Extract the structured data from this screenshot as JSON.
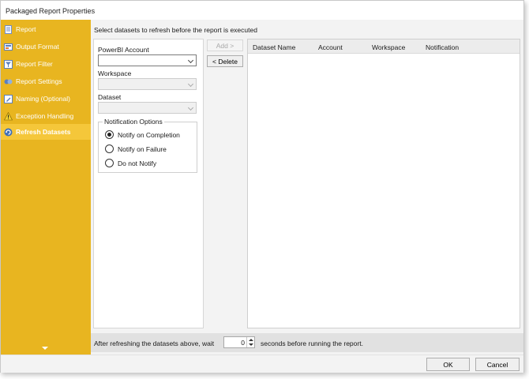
{
  "window": {
    "title": "Packaged Report Properties"
  },
  "sidebar": {
    "items": [
      {
        "label": "Report",
        "icon": "report-icon",
        "active": false
      },
      {
        "label": "Output Format",
        "icon": "output-format-icon",
        "active": false
      },
      {
        "label": "Report Filter",
        "icon": "filter-icon",
        "active": false
      },
      {
        "label": "Report Settings",
        "icon": "settings-icon",
        "active": false
      },
      {
        "label": "Naming (Optional)",
        "icon": "naming-icon",
        "active": false
      },
      {
        "label": "Exception Handling",
        "icon": "warning-icon",
        "active": false
      },
      {
        "label": "Refresh Datasets",
        "icon": "refresh-icon",
        "active": true
      }
    ],
    "expand_icon": "chevron-down-icon"
  },
  "main": {
    "instruction": "Select datasets to refresh before the report is executed",
    "powerbi_account_label": "PowerBI Account",
    "powerbi_account_value": "",
    "workspace_label": "Workspace",
    "workspace_value": "",
    "dataset_label": "Dataset",
    "dataset_value": "",
    "notification_title": "Notification Options",
    "notification_options": [
      {
        "label": "Notify on Completion",
        "checked": true
      },
      {
        "label": "Notify on Failure",
        "checked": false
      },
      {
        "label": "Do not Notify",
        "checked": false
      }
    ],
    "add_button": "Add >",
    "delete_button": "< Delete",
    "grid_columns": [
      "Dataset Name",
      "Account",
      "Workspace",
      "Notification"
    ],
    "grid_rows": []
  },
  "bottom": {
    "wait_prefix": "After refreshing the datasets above, wait",
    "wait_value": "0",
    "wait_suffix": "seconds before running the report."
  },
  "footer": {
    "ok_label": "OK",
    "cancel_label": "Cancel"
  },
  "colors": {
    "sidebar": "#e8b520",
    "sidebar_active": "#f5c73a"
  }
}
